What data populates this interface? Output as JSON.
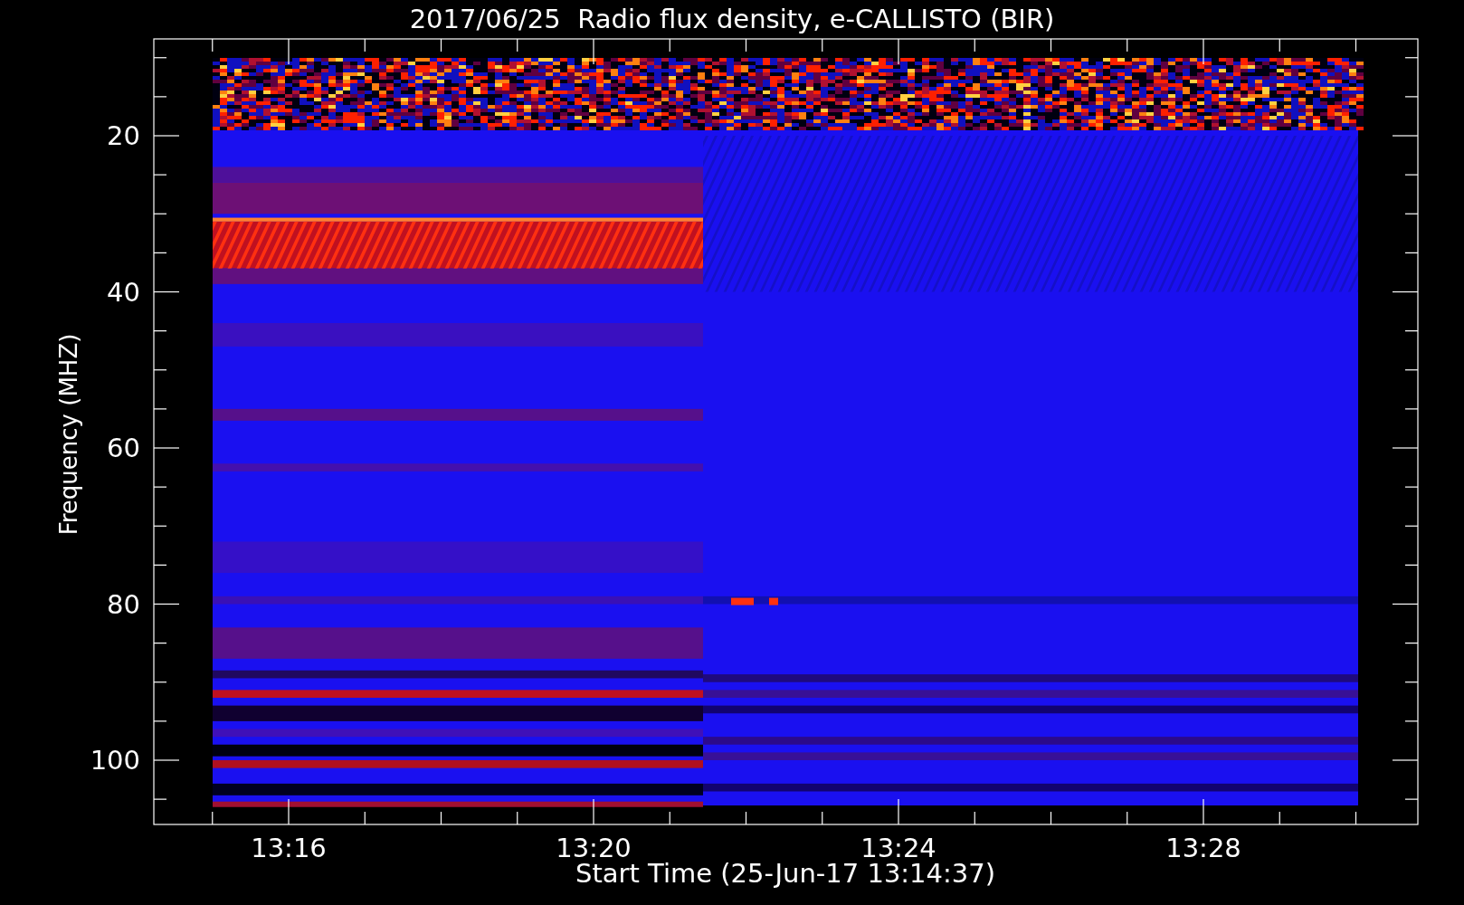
{
  "chart": {
    "title": "2017/06/25  Radio flux density, e-CALLISTO (BIR)",
    "y_axis": {
      "label": "Frequency (MHZ)",
      "ticks": [
        "20",
        "40",
        "60",
        "80",
        "100"
      ]
    },
    "x_axis": {
      "label": "Start Time (25-Jun-17 13:14:37)",
      "ticks": [
        "13:16",
        "13:20",
        "13:24",
        "13:28"
      ]
    }
  }
}
